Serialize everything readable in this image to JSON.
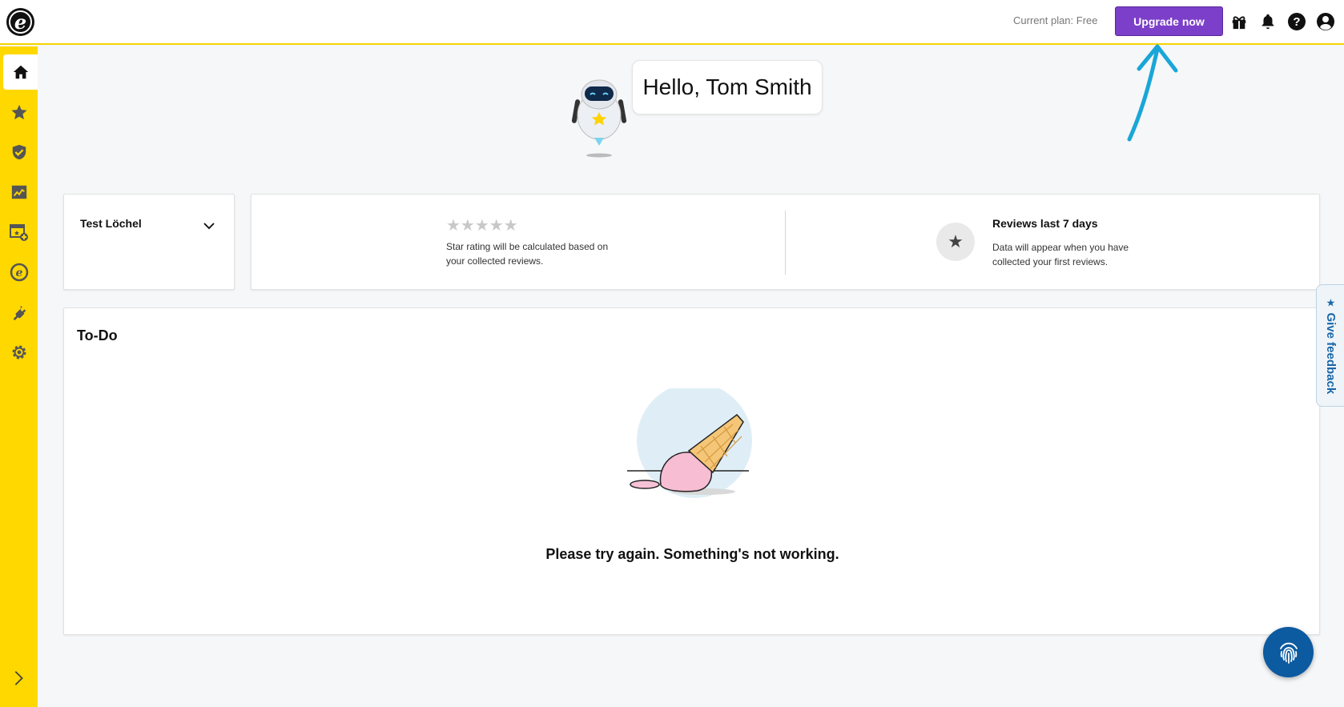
{
  "header": {
    "logo_letter": "e",
    "plan_label": "Current plan: Free",
    "upgrade_label": "Upgrade now",
    "icons": [
      "gift-icon",
      "bell-icon",
      "help-icon",
      "account-icon"
    ]
  },
  "sidebar": {
    "items": [
      {
        "name": "home",
        "icon": "home-icon",
        "active": true
      },
      {
        "name": "reviews",
        "icon": "star-icon",
        "active": false
      },
      {
        "name": "trustmark",
        "icon": "shield-check-icon",
        "active": false
      },
      {
        "name": "analytics",
        "icon": "chart-icon",
        "active": false
      },
      {
        "name": "add-page",
        "icon": "browser-add-icon",
        "active": false
      },
      {
        "name": "etrusted",
        "icon": "e-logo-icon",
        "active": false
      },
      {
        "name": "integrations",
        "icon": "plug-icon",
        "active": false
      },
      {
        "name": "settings",
        "icon": "gear-icon",
        "active": false
      }
    ],
    "expand_icon": "chevron-right-icon"
  },
  "greeting": {
    "text": "Hello, Tom Smith"
  },
  "location": {
    "name": "Test Löchel"
  },
  "stats": {
    "stars_glyph": "★★★★★",
    "star_rating_text": "Star rating will be calculated based on your collected reviews.",
    "reviews_title": "Reviews last 7 days",
    "reviews_text": "Data will appear when you have collected your first reviews.",
    "star_icon_glyph": "★"
  },
  "todo": {
    "title": "To-Do",
    "error_message": "Please try again. Something's not working."
  },
  "feedback": {
    "label": "Give feedback",
    "star_glyph": "★"
  },
  "colors": {
    "sidebar_yellow": "#ffd800",
    "upgrade_purple": "#7c3fc9",
    "feedback_blue": "#1a66a8",
    "fingerprint_button": "#0c5aa0",
    "annotation_arrow": "#1aa6d8"
  }
}
